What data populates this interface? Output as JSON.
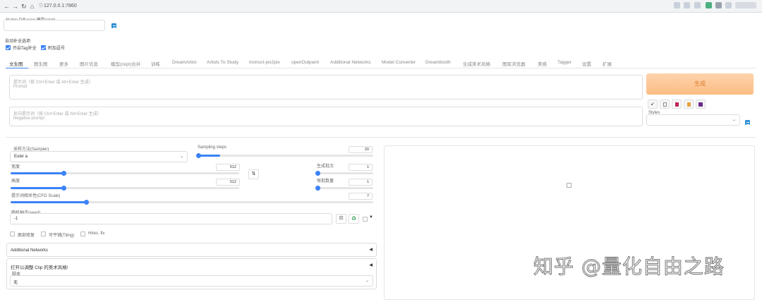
{
  "browser": {
    "url": "127.0.0.1:7860"
  },
  "checkpoint": {
    "label": "Stable Diffusion 模型(ckpt)",
    "value": ""
  },
  "autocomplete": {
    "title": "自动补全选项",
    "opt1": "开启Tag补全",
    "opt2": "附加逗号"
  },
  "tabs": [
    {
      "label": "文生图",
      "active": true
    },
    {
      "label": "图生图"
    },
    {
      "label": "更多"
    },
    {
      "label": "图片信息"
    },
    {
      "label": "模型(ckpt)合并"
    },
    {
      "label": "训练"
    },
    {
      "label": "DreamArtist"
    },
    {
      "label": "Artists To Study"
    },
    {
      "label": "Instruct-pix2pix"
    },
    {
      "label": "openOutpaint"
    },
    {
      "label": "Additional Networks"
    },
    {
      "label": "Model Converter"
    },
    {
      "label": "Dreambooth"
    },
    {
      "label": "生成美术风格"
    },
    {
      "label": "图库浏览器"
    },
    {
      "label": "美感"
    },
    {
      "label": "Tagger"
    },
    {
      "label": "设置"
    },
    {
      "label": "扩展"
    }
  ],
  "prompt": {
    "label": "提示词（按 Ctrl+Enter 或 Alt+Enter 生成）",
    "placeholder": "Prompt"
  },
  "negative": {
    "label": "反向提示词（按 Ctrl+Enter 或 Alt+Enter 生成）",
    "placeholder": "Negative prompt"
  },
  "generate": {
    "label": "生成"
  },
  "styles": {
    "label": "Styles"
  },
  "sampler": {
    "label": "采样方法(Sampler)",
    "value": "Euler a"
  },
  "steps": {
    "label": "Sampling steps",
    "value": "20",
    "fraction": 0.13
  },
  "width": {
    "label": "宽度",
    "value": "512",
    "fraction": 0.23
  },
  "height": {
    "label": "高度",
    "value": "512",
    "fraction": 0.23
  },
  "batch_count": {
    "label": "生成批次",
    "value": "1",
    "fraction": 0.0
  },
  "batch_size": {
    "label": "每批数量",
    "value": "1",
    "fraction": 0.0
  },
  "cfg": {
    "label": "提示词相关性(CFG Scale)",
    "value": "7",
    "fraction": 0.21
  },
  "seed": {
    "label": "随机种子(seed)",
    "value": "-1"
  },
  "options": {
    "restore_faces": "面部修复",
    "tiling": "可平铺(Tiling)",
    "hires": "Hires. fix"
  },
  "additional_networks": {
    "label": "Additional Networks"
  },
  "clip": {
    "label": "打开以调整 Clip 的美术风格!"
  },
  "script": {
    "label": "脚本",
    "value": "无"
  },
  "watermark": "知乎 @量化自由之路",
  "colors": {
    "accent": "#3b82f6",
    "generate_bg": "#fbc190",
    "generate_text": "#e07a2b"
  }
}
